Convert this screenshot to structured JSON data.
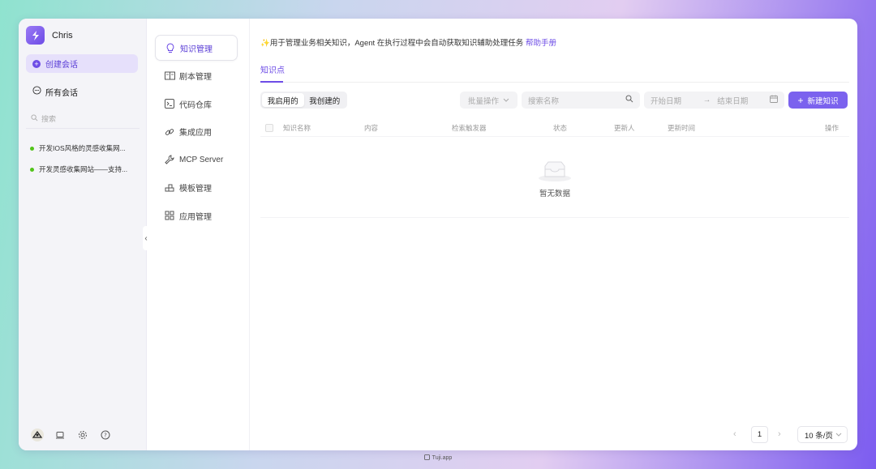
{
  "user": {
    "name": "Chris"
  },
  "sidebar": {
    "new_chat_label": "创建会话",
    "all_chats_label": "所有会话",
    "search_placeholder": "搜索",
    "history": [
      {
        "title": "开发IOS风格的灵感收集网..."
      },
      {
        "title": "开发灵感收集网站——支持..."
      }
    ]
  },
  "nav": {
    "items": [
      {
        "label": "知识管理",
        "icon": "lightbulb-icon",
        "active": true
      },
      {
        "label": "剧本管理",
        "icon": "book-icon"
      },
      {
        "label": "代码仓库",
        "icon": "terminal-icon"
      },
      {
        "label": "集成应用",
        "icon": "link-icon"
      },
      {
        "label": "MCP Server",
        "icon": "wrench-icon"
      },
      {
        "label": "模板管理",
        "icon": "template-icon"
      },
      {
        "label": "应用管理",
        "icon": "grid-icon"
      }
    ]
  },
  "main": {
    "intro_prefix": "✨用于管理业务相关知识，Agent 在执行过程中会自动获取知识辅助处理任务",
    "intro_link": "帮助手册",
    "tab": "知识点",
    "segments": [
      "我启用的",
      "我创建的"
    ],
    "bulk_label": "批量操作",
    "search_placeholder": "搜索名称",
    "date_start_placeholder": "开始日期",
    "date_end_placeholder": "结束日期",
    "new_button_label": "新建知识",
    "columns": [
      "知识名称",
      "内容",
      "检索触发器",
      "状态",
      "更新人",
      "更新时间",
      "操作"
    ],
    "empty_text": "暂无数据",
    "pagination": {
      "current_page": "1",
      "page_size": "10 条/页"
    }
  },
  "footer": {
    "label": "Tuji.app"
  },
  "colors": {
    "accent": "#6d4ce6",
    "button": "#7b62ee",
    "status_dot": "#52c41a"
  }
}
